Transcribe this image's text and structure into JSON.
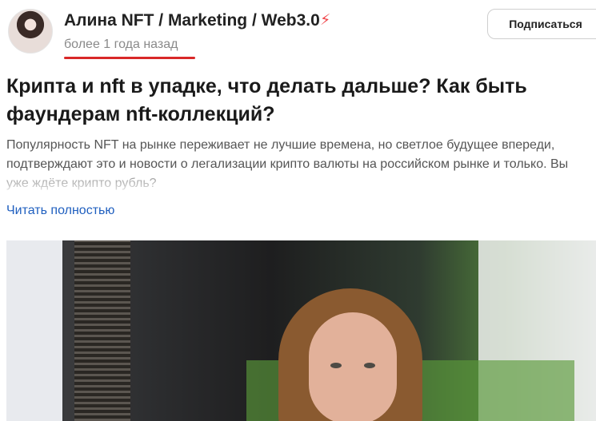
{
  "post": {
    "author": "Алина NFT / Marketing / Web3.0",
    "time_ago": "более 1 года назад",
    "subscribe_label": "Подписаться",
    "title": "Крипта и nft в упадке, что делать дальше? Как быть фаундерам nft-коллекций?",
    "excerpt": "Популярность NFT на рынке переживает не лучшие времена, но светлое будущее впереди, подтверждают это и новости о легализации крипто валюты на российском рынке и только. Вы уже ждёте крипто рубль?",
    "read_more": "Читать полностью"
  },
  "icons": {
    "bolt": "lightning-icon"
  },
  "colors": {
    "accent": "#d92828",
    "link": "#1f5fbf",
    "bolt": "#f0454a"
  }
}
